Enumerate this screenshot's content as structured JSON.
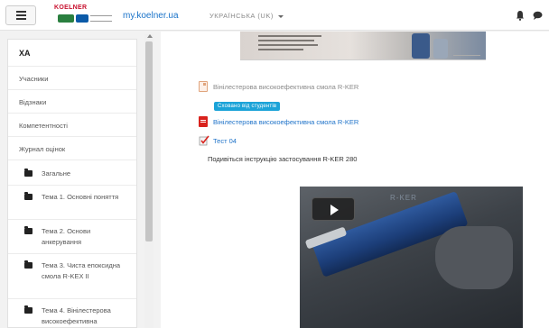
{
  "header": {
    "logo_brand": "KOELNER",
    "site_link": "my.koelner.ua",
    "language": "УКРАЇНСЬКА (UK)"
  },
  "sidebar": {
    "title": "ХА",
    "items": [
      {
        "label": "Учасники"
      },
      {
        "label": "Відзнаки"
      },
      {
        "label": "Компетентності"
      },
      {
        "label": "Журнал оцінок"
      }
    ],
    "folders": [
      {
        "label": "Загальне"
      },
      {
        "label": "Тема 1. Основні поняття"
      },
      {
        "label": "Тема 2. Основи анкерування"
      },
      {
        "label": "Тема 3. Чиста епоксидна смола R-KEX II"
      },
      {
        "label": "Тема 4. Вінілестерова високоефективна"
      }
    ]
  },
  "main": {
    "activities": [
      {
        "label": "Вінілестерова високоефективна смола R-KER"
      },
      {
        "label": "Вінілестерова високоефективна смола R-KER"
      },
      {
        "label": "Тест 04"
      }
    ],
    "badge": "Сховано від студентів",
    "instruction": "Подивіться інструкцію застосування R-KER 280",
    "video_label": "R-KER"
  },
  "colors": {
    "link": "#1f73c9",
    "badge": "#1ba3d8",
    "pdf_icon": "#d9221d"
  }
}
